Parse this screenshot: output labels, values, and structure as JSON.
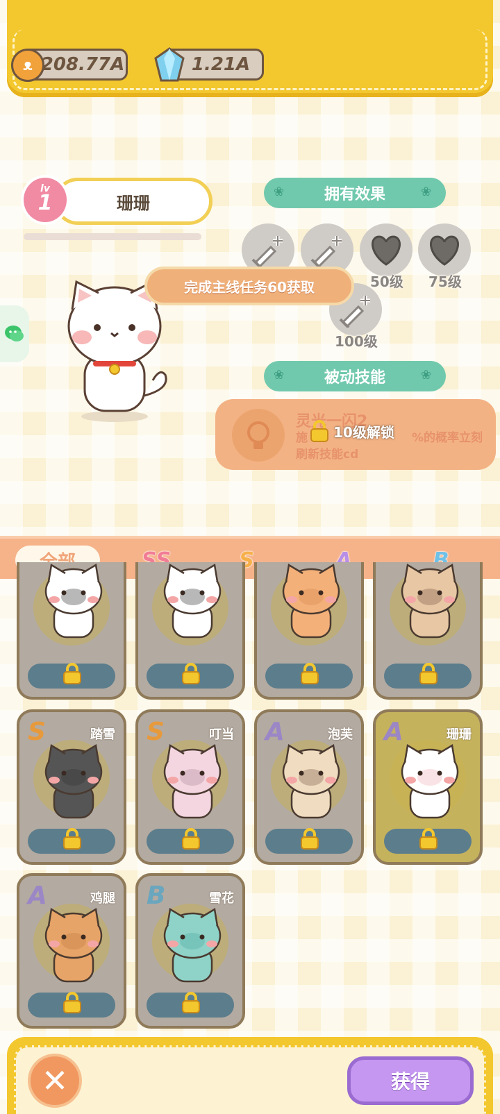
{
  "currency": {
    "coins": "208.77A",
    "gems": "1.21A"
  },
  "cat": {
    "level_prefix": "lv",
    "level": "1",
    "name": "珊珊"
  },
  "effects": {
    "header": "拥有效果",
    "unlock_banner": "完成主线任务60获取",
    "items": [
      {
        "icon": "sword-plus-icon",
        "label": ""
      },
      {
        "icon": "sword-plus-icon",
        "label": ""
      },
      {
        "icon": "heart-icon",
        "label": "50级"
      },
      {
        "icon": "heart-icon",
        "label": "75级"
      },
      {
        "icon": "sword-plus-icon",
        "label": "100级"
      }
    ]
  },
  "passive": {
    "header": "被动技能",
    "skill_name": "灵光一闪2",
    "skill_desc_1": "施",
    "skill_desc_2": "%的概率立刻",
    "skill_desc_3": "刷新技能cd",
    "lock_text": "10级解锁"
  },
  "tabs": [
    {
      "label": "全部",
      "color": "#f0a57a"
    },
    {
      "label": "SS",
      "color": "#f17d95"
    },
    {
      "label": "S",
      "color": "#f6b04a"
    },
    {
      "label": "A",
      "color": "#b88ee6"
    },
    {
      "label": "B",
      "color": "#6ec0e6"
    }
  ],
  "cards": [
    {
      "rarity": "",
      "name": "",
      "fur": "#ffffff",
      "accent": "#333333"
    },
    {
      "rarity": "",
      "name": "",
      "fur": "#ffffff",
      "accent": "#333333"
    },
    {
      "rarity": "",
      "name": "",
      "fur": "#f3b079",
      "accent": "#d98a52"
    },
    {
      "rarity": "",
      "name": "",
      "fur": "#e8c7a4",
      "accent": "#7a5a4a"
    },
    {
      "rarity": "S",
      "name": "踏雪",
      "fur": "#555555",
      "accent": "#333333"
    },
    {
      "rarity": "S",
      "name": "叮当",
      "fur": "#f3d6e0",
      "accent": "#b28a9a"
    },
    {
      "rarity": "A",
      "name": "泡芙",
      "fur": "#f0dcc0",
      "accent": "#7a5a4a"
    },
    {
      "rarity": "A",
      "name": "珊珊",
      "fur": "#ffffff",
      "accent": "#f0b0b8"
    },
    {
      "rarity": "A",
      "name": "鸡腿",
      "fur": "#e7a468",
      "accent": "#c47d43"
    },
    {
      "rarity": "B",
      "name": "雪花",
      "fur": "#8fd3c8",
      "accent": "#4aa8a0"
    }
  ],
  "buttons": {
    "close": "✕",
    "obtain": "获得"
  }
}
